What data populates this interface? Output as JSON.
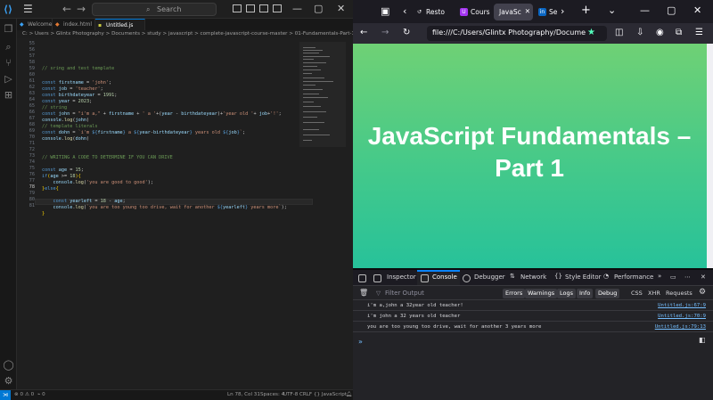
{
  "vscode": {
    "menu_icon": "hamburger-icon",
    "search_placeholder": "Search",
    "tabs": [
      {
        "label": "Welcome",
        "icon": "vscode-icon"
      },
      {
        "label": "index.html",
        "icon": "html-icon"
      },
      {
        "label": "Untitled.js",
        "icon": "js-icon"
      }
    ],
    "breadcrumb": "C: > Users > Glintx Photography > Documents > study > javascript > complete-javascript-course-master > 01-Fundamentals-Part-1 > starter > JS Untitled.js > ...",
    "line_numbers": [
      "55",
      "56",
      "57",
      "58",
      "59",
      "60",
      "61",
      "62",
      "63",
      "64",
      "65",
      "66",
      "67",
      "68",
      "69",
      "70",
      "71",
      "72",
      "73",
      "74",
      "75",
      "76",
      "77",
      "78",
      "79",
      "80",
      "81"
    ],
    "status": {
      "errors": "0",
      "warnings": "0",
      "ports": "0",
      "position": "Ln 78, Col 31",
      "spaces": "Spaces: 4",
      "encoding": "UTF-8",
      "eol": "CRLF",
      "language": "JavaScript"
    }
  },
  "firefox": {
    "tabs": [
      {
        "label": "Resto",
        "icon": "restore-icon"
      },
      {
        "label": "Cours",
        "icon": "udemy-icon"
      },
      {
        "label": "JavaSc",
        "icon": "page-icon"
      },
      {
        "label": "Se",
        "icon": "linkedin-icon"
      }
    ],
    "url": "file:///C:/Users/Glintx Photography/Docume",
    "page_heading": "JavaScript Fundamentals – Part 1",
    "devtools": {
      "tabs": [
        "Inspector",
        "Console",
        "Debugger",
        "Network",
        "Style Editor",
        "Performance"
      ],
      "active_tab": "Console",
      "filter_placeholder": "Filter Output",
      "levels": [
        "Errors",
        "Warnings",
        "Logs",
        "Info",
        "Debug"
      ],
      "toggles": [
        "CSS",
        "XHR",
        "Requests"
      ],
      "logs": [
        {
          "message": "i'm a,john a 32year old teacher!",
          "source": "Untitled.js:67:9"
        },
        {
          "message": "i'm john a 32 years old teacher",
          "source": "Untitled.js:70:9"
        },
        {
          "message": "you are too young too drive, wait for another 3 years more",
          "source": "Untitled.js:79:13"
        }
      ],
      "prompt": "»"
    }
  }
}
